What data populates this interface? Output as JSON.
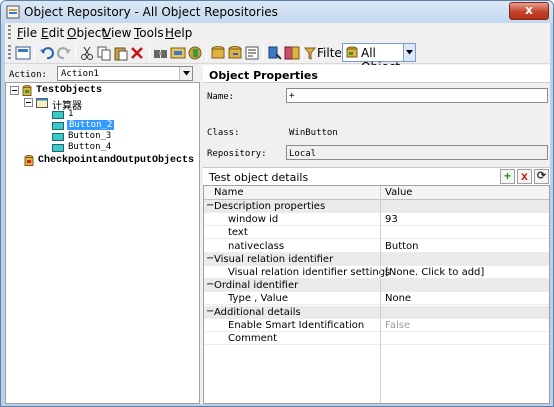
{
  "window": {
    "title": "Object Repository - All Object Repositories",
    "close_glyph": "x"
  },
  "menu": [
    "File",
    "Edit",
    "Object",
    "View",
    "Tools",
    "Help"
  ],
  "menu_accel": [
    "F",
    "E",
    "O",
    "V",
    "T",
    "H"
  ],
  "menu_rest": [
    "ile",
    "dit",
    "bject",
    "iew",
    "ools",
    "elp"
  ],
  "toolbar": {
    "filter_label": "Filter:",
    "filter_value": "All Object",
    "icons": [
      "new-object-icon",
      "undo-icon",
      "redo-icon",
      "cut-icon",
      "copy-icon",
      "paste-icon",
      "delete-icon",
      "find-icon",
      "highlight-icon",
      "add-objects-icon",
      "export-icon",
      "update-icon",
      "properties-icon",
      "locate-icon",
      "compare-icon",
      "filter-icon"
    ]
  },
  "action": {
    "label": "Action:",
    "value": "Action1"
  },
  "tree": {
    "root": "TestObjects",
    "window": "计算器",
    "items": [
      "1",
      "Button_2",
      "Button_3",
      "Button_4"
    ],
    "selected": "Button_2",
    "checkpoints": "CheckpointandOutputObjects"
  },
  "object_properties": {
    "title": "Object Properties",
    "name_label": "Name:",
    "name_value": "+",
    "class_label": "Class:",
    "class_value": "WinButton",
    "repository_label": "Repository:",
    "repository_value": "Local"
  },
  "details": {
    "title": "Test object details",
    "add_glyph": "+",
    "remove_glyph": "x",
    "refresh_glyph": "⟳",
    "col_name": "Name",
    "col_value": "Value",
    "rows": [
      {
        "cat": true,
        "toggle": "−",
        "name": "Description properties",
        "value": ""
      },
      {
        "cat": false,
        "name": "window id",
        "value": "93"
      },
      {
        "cat": false,
        "name": "text",
        "value": ""
      },
      {
        "cat": false,
        "name": "nativeclass",
        "value": "Button"
      },
      {
        "cat": true,
        "toggle": "−",
        "name": "Visual relation identifier",
        "value": ""
      },
      {
        "cat": false,
        "name": "Visual relation identifier settings",
        "value": "[None. Click to add]"
      },
      {
        "cat": true,
        "toggle": "−",
        "name": "Ordinal identifier",
        "value": ""
      },
      {
        "cat": false,
        "name": "Type , Value",
        "value": "None"
      },
      {
        "cat": true,
        "toggle": "−",
        "name": "Additional details",
        "value": ""
      },
      {
        "cat": false,
        "name": "Enable Smart Identification",
        "value": "False",
        "disabled": true
      },
      {
        "cat": false,
        "name": "Comment",
        "value": ""
      }
    ]
  },
  "colors": {
    "accent": "#3399ff",
    "add_green": "#1a9a1a",
    "remove_red": "#cc1111"
  }
}
